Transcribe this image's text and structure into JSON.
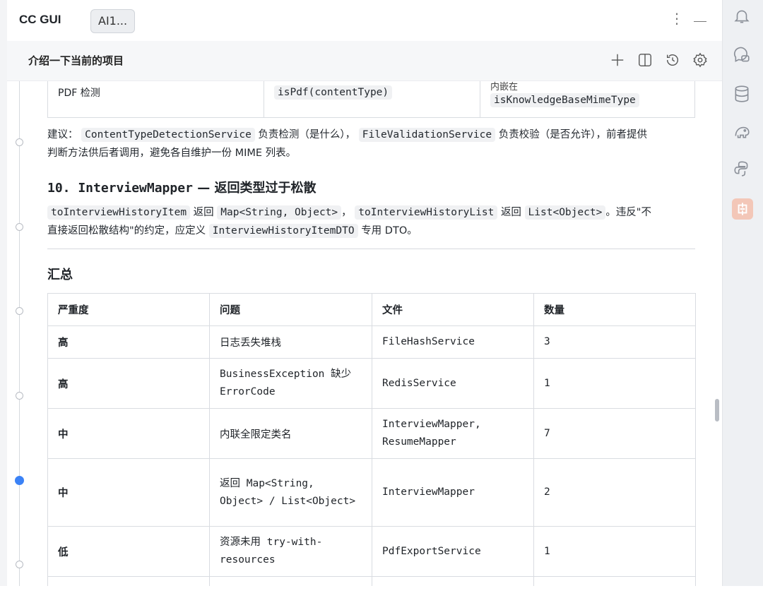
{
  "app": {
    "title": "CC GUI",
    "tab_label": "AI1..."
  },
  "header": {
    "session_title": "介绍一下当前的项目"
  },
  "top_table": {
    "col1": "PDF 检测",
    "col2": "isPdf(contentType)",
    "col3_top": "内嵌在",
    "col3_code": "isKnowledgeBaseMimeType"
  },
  "advice": {
    "lead": "建议：",
    "code1": "ContentTypeDetectionService",
    "t1": "负责检测（是什么），",
    "code2": "FileValidationService",
    "t2": "负责校验（是否允许），前者提供",
    "line2": "判断方法供后者调用，避免各自维护一份 MIME 列表。"
  },
  "section10": {
    "heading_code": "10. InterviewMapper",
    "heading_text": "— 返回类型过于松散",
    "code1": "toInterviewHistoryItem",
    "t1": "返回",
    "code2": "Map<String, Object>",
    "t2": "，",
    "code3": "toInterviewHistoryList",
    "t3": "返回",
    "code4": "List<Object>",
    "t4": "。违反\"不",
    "line2_a": "直接返回松散结构\"的约定，应定义",
    "code5": "InterviewHistoryItemDTO",
    "line2_b": "专用 DTO。"
  },
  "summary": {
    "heading": "汇总",
    "headers": [
      "严重度",
      "问题",
      "文件",
      "数量"
    ],
    "rows": [
      {
        "severity": "高",
        "issue": "日志丢失堆栈",
        "file": "FileHashService",
        "count": "3"
      },
      {
        "severity": "高",
        "issue": "BusinessException 缺少 ErrorCode",
        "file": "RedisService",
        "count": "1"
      },
      {
        "severity": "中",
        "issue": "内联全限定类名",
        "file": "InterviewMapper, ResumeMapper",
        "count": "7"
      },
      {
        "severity": "中",
        "issue": "返回 Map<String, Object> / List<Object>",
        "file": "InterviewMapper",
        "count": "2"
      },
      {
        "severity": "低",
        "issue": "资源未用 try-with-resources",
        "file": "PdfExportService",
        "count": "1"
      }
    ]
  },
  "icons": {
    "right_bar": [
      "bell-icon",
      "chat-bubbles-icon",
      "database-icon",
      "elephant-icon",
      "python-icon",
      "plugin-icon"
    ],
    "header": [
      "plus-icon",
      "split-view-icon",
      "history-icon",
      "gear-icon"
    ]
  }
}
